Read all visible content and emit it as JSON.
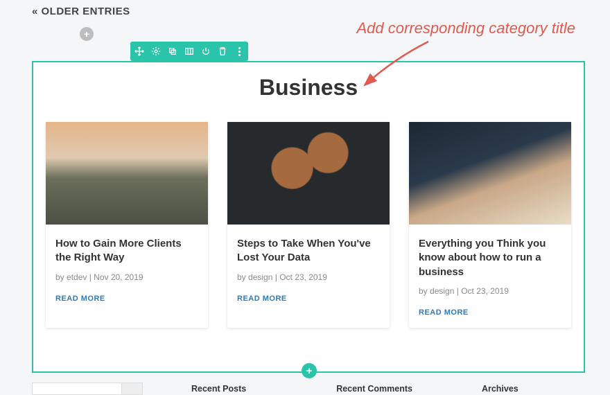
{
  "nav": {
    "older_entries": "« OLDER ENTRIES"
  },
  "annotation": {
    "text": "Add corresponding category title"
  },
  "section": {
    "title": "Business"
  },
  "toolbar": {
    "icons": [
      "move-icon",
      "gear-icon",
      "duplicate-icon",
      "columns-icon",
      "power-icon",
      "trash-icon",
      "more-icon"
    ]
  },
  "cards": [
    {
      "title": "How to Gain More Clients the Right Way",
      "author": "etdev",
      "date": "Nov 20, 2019",
      "readmore": "READ MORE"
    },
    {
      "title": "Steps to Take When You've Lost Your Data",
      "author": "design",
      "date": "Oct 23, 2019",
      "readmore": "READ MORE"
    },
    {
      "title": "Everything you Think you know about how to run a business",
      "author": "design",
      "date": "Oct 23, 2019",
      "readmore": "READ MORE"
    }
  ],
  "meta_prefix": "by ",
  "meta_sep": " | ",
  "footer": {
    "recent_posts": "Recent Posts",
    "recent_comments": "Recent Comments",
    "archives": "Archives"
  },
  "colors": {
    "accent": "#29c4a9",
    "annotation": "#e05a4f",
    "link": "#2b7bbd"
  }
}
